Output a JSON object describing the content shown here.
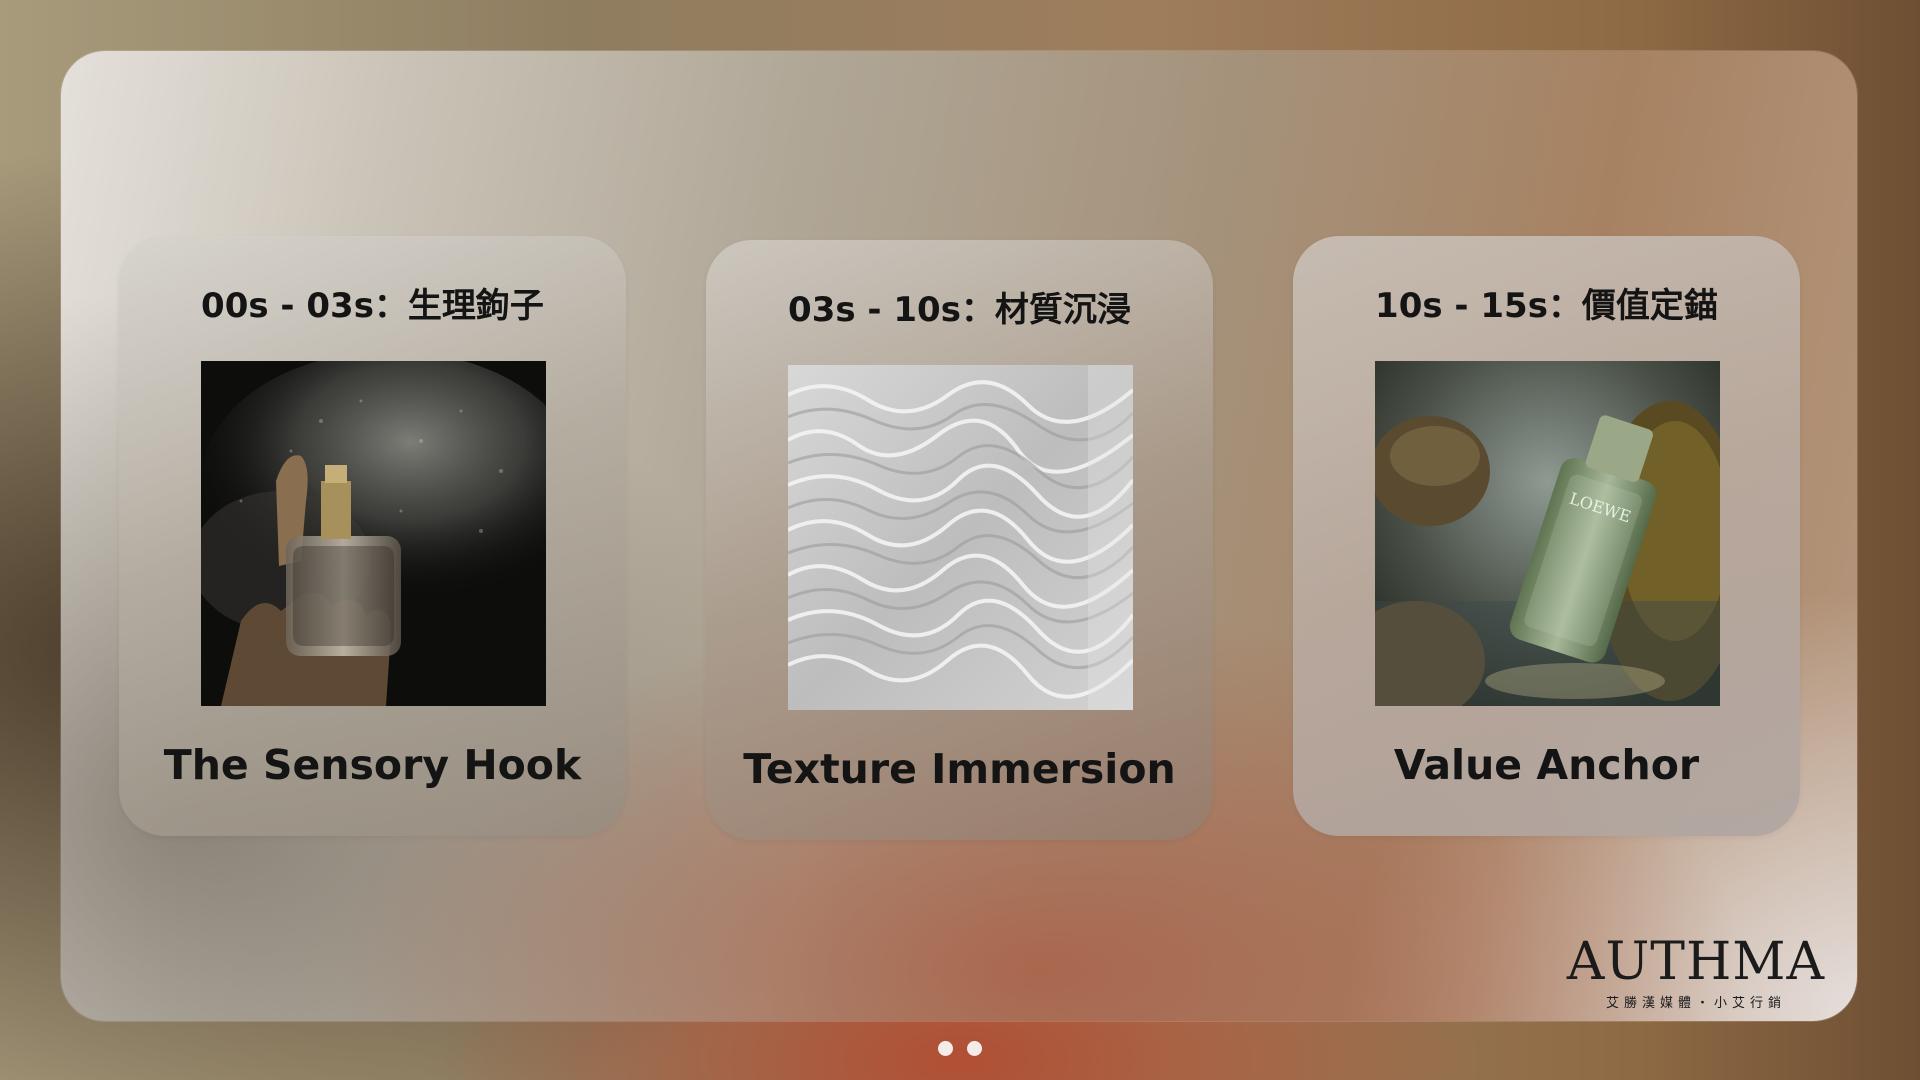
{
  "slides": [
    {
      "title": "00s - 03s：生理鉤子",
      "caption": "The Sensory Hook",
      "image": "perfume-spray-photo"
    },
    {
      "title": "03s - 10s：材質沉浸",
      "caption": "Texture Immersion",
      "image": "water-ripple-texture-photo"
    },
    {
      "title": "10s - 15s：價值定錨",
      "caption": "Value Anchor",
      "image": "loewe-bottle-on-moss-photo",
      "bottle_label": "LOEWE"
    }
  ],
  "logo": {
    "wordmark": "AUTHMA",
    "subtitle": "艾勝漢媒體・小艾行銷"
  },
  "pagination": {
    "count": 2
  },
  "colors": {
    "text": "#141414",
    "dot": "#f3ece8",
    "accent": "#b14f34"
  }
}
